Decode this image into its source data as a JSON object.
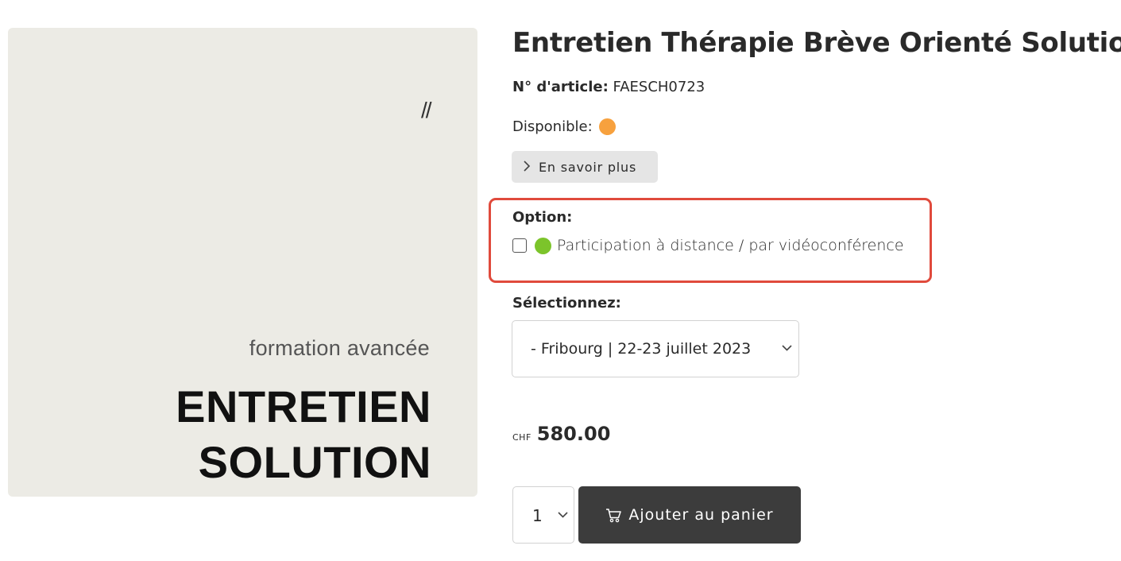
{
  "product": {
    "title": "Entretien Thérapie Brève Orienté Solution",
    "sku_label": "N° d'article:",
    "sku_value": "FAESCH0723",
    "availability_label": "Disponible:",
    "availability_color": "#f7a13e",
    "more_info_label": "En savoir plus"
  },
  "image": {
    "slashes": "//",
    "subtitle": "formation avancée",
    "title_line1": "ENTRETIEN",
    "title_line2": "SOLUTION"
  },
  "option": {
    "label": "Option:",
    "checkbox_checked": false,
    "item_label": "Participation à distance / par vidéoconférence",
    "item_color": "#7cc42b",
    "highlight_color": "#e04a3c"
  },
  "date_select": {
    "label": "Sélectionnez:",
    "selected": "- Fribourg | 22-23 juillet 2023"
  },
  "price": {
    "currency": "CHF",
    "amount": "580.00"
  },
  "cart": {
    "quantity": "1",
    "add_label": "Ajouter au panier",
    "button_color": "#3c3c3c"
  }
}
